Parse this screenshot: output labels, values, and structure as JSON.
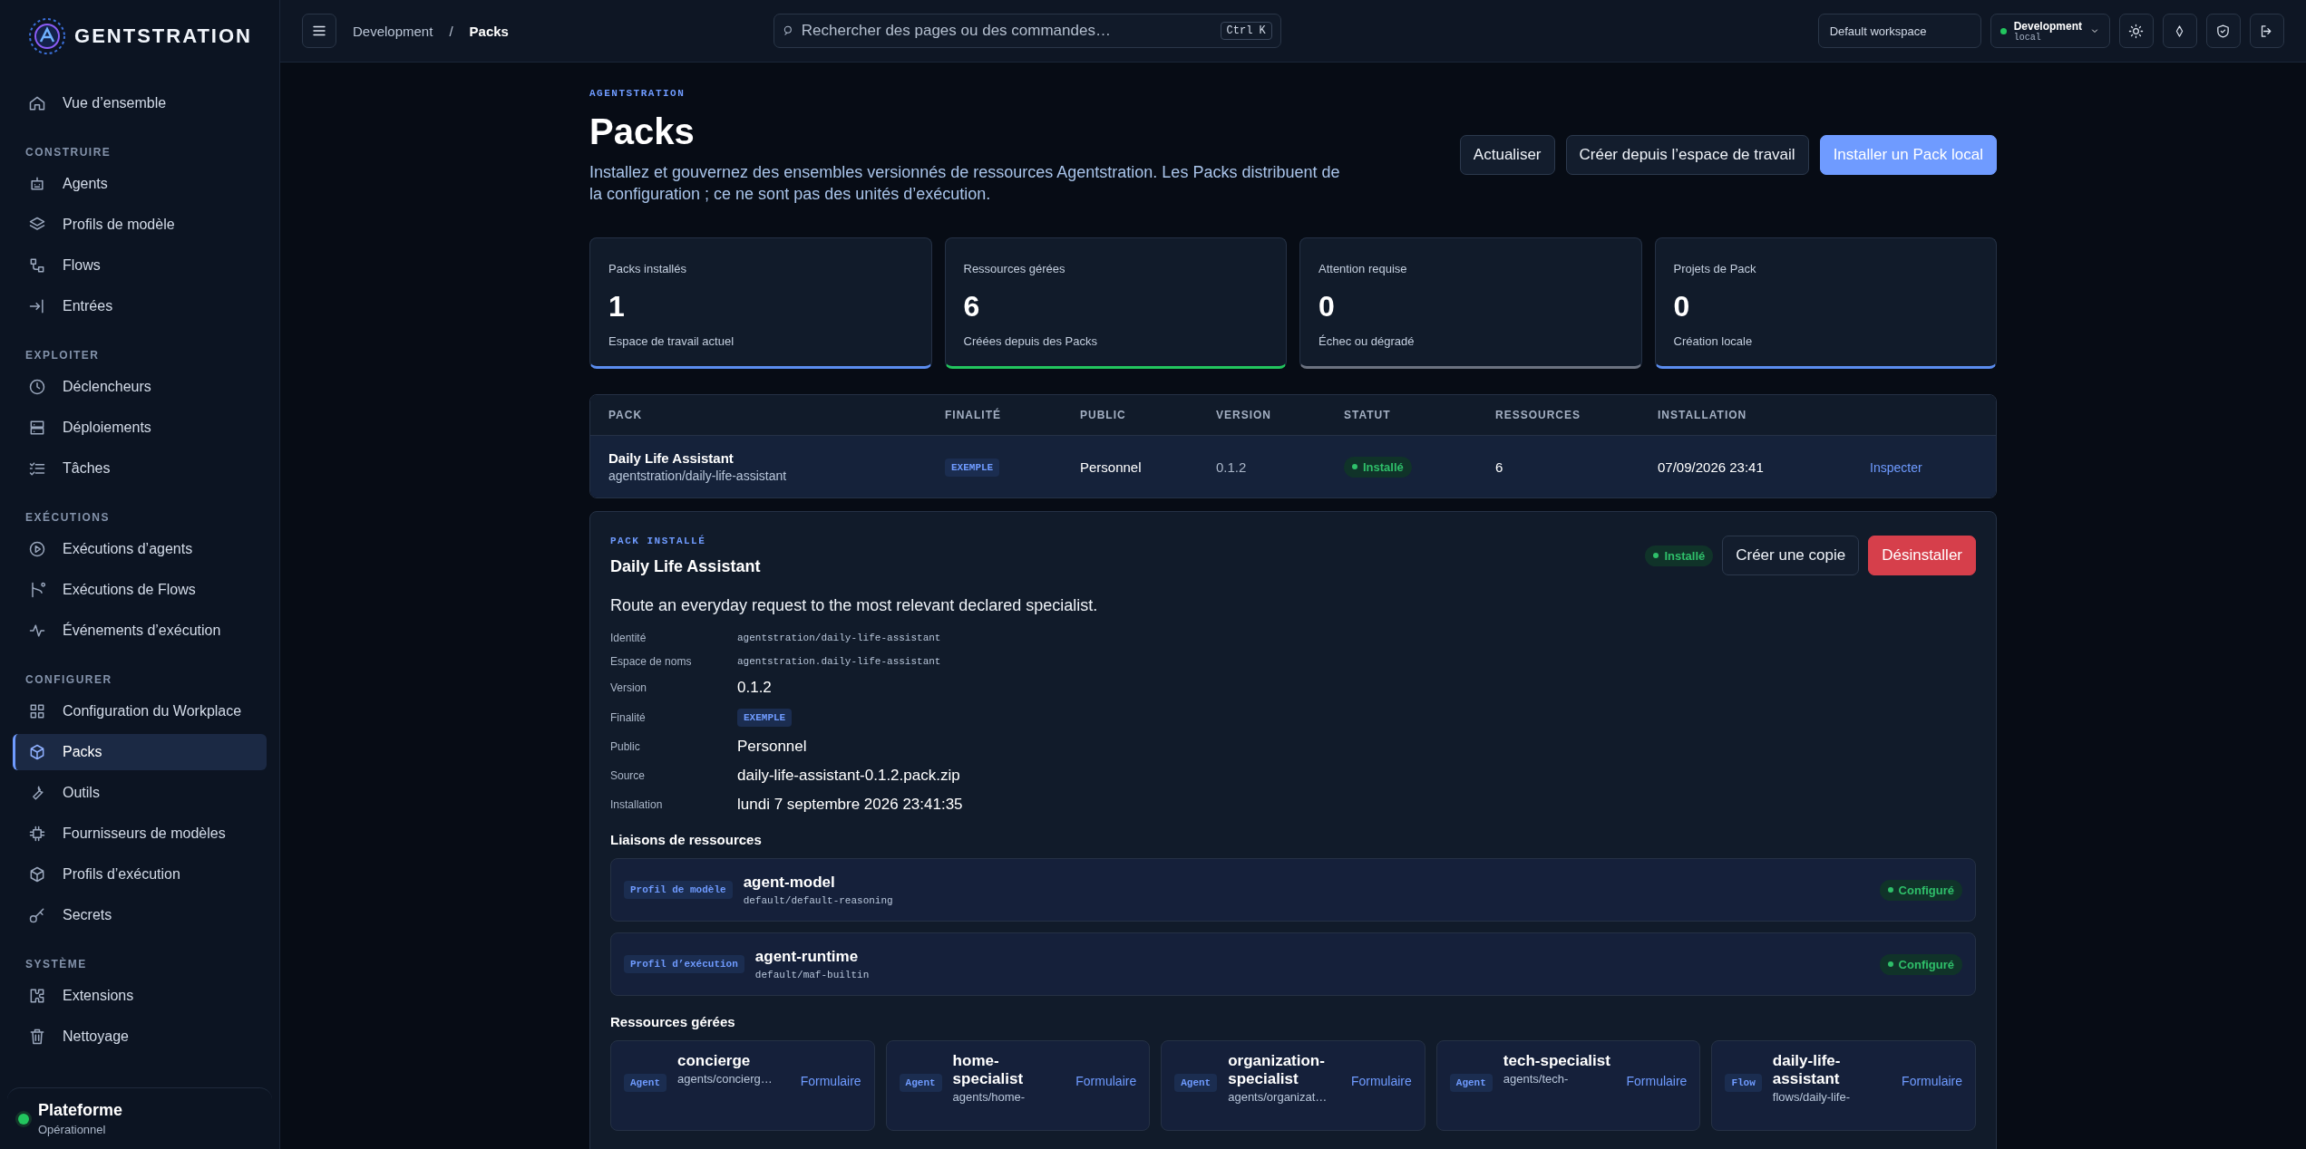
{
  "brand": {
    "logo_text": "GENTSTRATION"
  },
  "sidebar": {
    "sections": [
      {
        "items": [
          {
            "label": "Vue d’ensemble",
            "selected": false
          }
        ]
      },
      {
        "heading": "CONSTRUIRE",
        "items": [
          {
            "label": "Agents",
            "selected": false
          },
          {
            "label": "Profils de modèle",
            "selected": false
          },
          {
            "label": "Flows",
            "selected": false
          },
          {
            "label": "Entrées",
            "selected": false
          }
        ]
      },
      {
        "heading": "EXPLOITER",
        "items": [
          {
            "label": "Déclencheurs",
            "selected": false
          },
          {
            "label": "Déploiements",
            "selected": false
          },
          {
            "label": "Tâches",
            "selected": false
          }
        ]
      },
      {
        "heading": "EXÉCUTIONS",
        "items": [
          {
            "label": "Exécutions d’agents",
            "selected": false
          },
          {
            "label": "Exécutions de Flows",
            "selected": false
          },
          {
            "label": "Événements d’exécution",
            "selected": false
          }
        ]
      },
      {
        "heading": "CONFIGURER",
        "items": [
          {
            "label": "Configuration du Workplace",
            "selected": false
          },
          {
            "label": "Packs",
            "selected": true
          },
          {
            "label": "Outils",
            "selected": false
          },
          {
            "label": "Fournisseurs de modèles",
            "selected": false
          },
          {
            "label": "Profils d’exécution",
            "selected": false
          },
          {
            "label": "Secrets",
            "selected": false
          }
        ]
      },
      {
        "heading": "SYSTÈME",
        "items": [
          {
            "label": "Extensions",
            "selected": false
          },
          {
            "label": "Nettoyage",
            "selected": false
          }
        ]
      }
    ],
    "footer": {
      "title": "Plateforme",
      "subtitle": "Opérationnel"
    }
  },
  "topbar": {
    "breadcrumb": [
      "Development",
      "Packs"
    ],
    "breadcrumb_separator": "/",
    "search": {
      "placeholder": "Rechercher des pages ou des commandes…",
      "shortcut": "Ctrl K"
    },
    "workspace": "Default workspace",
    "environment": {
      "name": "Development",
      "detail": "local"
    }
  },
  "header": {
    "eyebrow": "AGENTSTRATION",
    "title": "Packs",
    "description": "Installez et gouvernez des ensembles versionnés de ressources Agentstration. Les Packs distribuent de la configuration ; ce ne sont pas des unités d’exécution.",
    "buttons": [
      {
        "label": "Actualiser",
        "kind": "secondary"
      },
      {
        "label": "Créer depuis l’espace de travail",
        "kind": "secondary"
      },
      {
        "label": "Installer un Pack local",
        "kind": "primary"
      }
    ]
  },
  "stats": [
    {
      "label": "Packs installés",
      "value": "1",
      "caption": "Espace de travail actuel",
      "color": "#5b8def"
    },
    {
      "label": "Ressources gérées",
      "value": "6",
      "caption": "Créées depuis des Packs",
      "color": "#22c55e"
    },
    {
      "label": "Attention requise",
      "value": "0",
      "caption": "Échec ou dégradé",
      "color": "#6b7280"
    },
    {
      "label": "Projets de Pack",
      "value": "0",
      "caption": "Création locale",
      "color": "#5b8def"
    }
  ],
  "table": {
    "columns": [
      "PACK",
      "FINALITÉ",
      "PUBLIC",
      "VERSION",
      "STATUT",
      "RESSOURCES",
      "INSTALLATION"
    ],
    "rows": [
      {
        "name": "Daily Life Assistant",
        "path": "agentstration/daily-life-assistant",
        "purpose": "EXEMPLE",
        "audience": "Personnel",
        "version": "0.1.2",
        "status": "Installé",
        "resources": "6",
        "installed": "07/09/2026 23:41",
        "action": "Inspecter"
      }
    ]
  },
  "detail": {
    "eyebrow": "PACK INSTALLÉ",
    "title": "Daily Life Assistant",
    "status": "Installé",
    "buttons": [
      {
        "label": "Créer une copie",
        "kind": "secondary"
      },
      {
        "label": "Désinstaller",
        "kind": "danger"
      }
    ],
    "description": "Route an everyday request to the most relevant declared specialist.",
    "fields": [
      {
        "label": "Identité",
        "value": "agentstration/daily-life-assistant",
        "kind": "mono"
      },
      {
        "label": "Espace de noms",
        "value": "agentstration.daily-life-assistant",
        "kind": "mono"
      },
      {
        "label": "Version",
        "value": "0.1.2",
        "kind": "text"
      },
      {
        "label": "Finalité",
        "value": "EXEMPLE",
        "kind": "tag"
      },
      {
        "label": "Public",
        "value": "Personnel",
        "kind": "text"
      },
      {
        "label": "Source",
        "value": "daily-life-assistant-0.1.2.pack.zip",
        "kind": "text"
      },
      {
        "label": "Installation",
        "value": "lundi 7 septembre 2026 23:41:35",
        "kind": "text"
      }
    ],
    "bindings_heading": "Liaisons de ressources",
    "bindings": [
      {
        "tag": "Profil de modèle",
        "name": "agent-model",
        "ref": "default/default-reasoning",
        "status": "Configuré"
      },
      {
        "tag": "Profil d’exécution",
        "name": "agent-runtime",
        "ref": "default/maf-builtin",
        "status": "Configuré"
      }
    ],
    "resources_heading": "Ressources gérées",
    "resources": [
      {
        "tag": "Agent",
        "name": "concierge",
        "path": "agents/concierg…",
        "action": "Formulaire"
      },
      {
        "tag": "Agent",
        "name": "home-specialist",
        "path": "agents/home-",
        "action": "Formulaire"
      },
      {
        "tag": "Agent",
        "name": "organization-specialist",
        "path": "agents/organizat…",
        "action": "Formulaire"
      },
      {
        "tag": "Agent",
        "name": "tech-specialist",
        "path": "agents/tech-",
        "action": "Formulaire"
      },
      {
        "tag": "Flow",
        "name": "daily-life-assistant",
        "path": "flows/daily-life-",
        "action": "Formulaire"
      }
    ]
  }
}
